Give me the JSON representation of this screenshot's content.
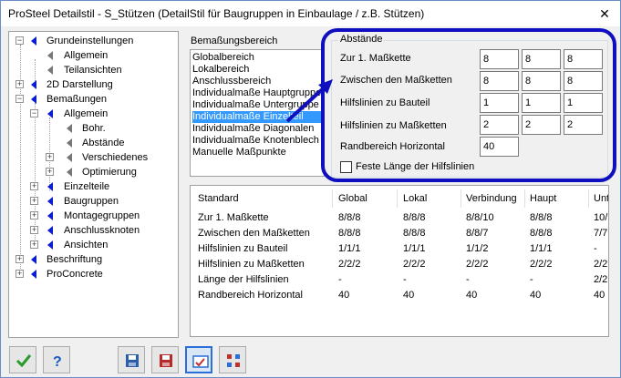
{
  "window": {
    "title": "ProSteel Detailstil - S_Stützen (DetailStil für Baugruppen in Einbaulage / z.B. Stützen)",
    "close_glyph": "✕"
  },
  "tree": {
    "items": [
      {
        "label": "Grundeinstellungen",
        "icon": "blue-triangle-icon"
      },
      {
        "label": "Allgemein",
        "icon": "gray-triangle-icon"
      },
      {
        "label": "Teilansichten",
        "icon": "gray-triangle-icon"
      },
      {
        "label": "2D Darstellung",
        "icon": "blue-triangle-icon"
      },
      {
        "label": "Bemaßungen",
        "icon": "blue-triangle-icon"
      },
      {
        "label": "Allgemein",
        "icon": "blue-triangle-icon"
      },
      {
        "label": "Bohr.",
        "icon": "gray-triangle-icon"
      },
      {
        "label": "Abstände",
        "icon": "gray-triangle-icon"
      },
      {
        "label": "Verschiedenes",
        "icon": "gray-triangle-icon"
      },
      {
        "label": "Optimierung",
        "icon": "gray-triangle-icon"
      },
      {
        "label": "Einzelteile",
        "icon": "blue-triangle-icon"
      },
      {
        "label": "Baugruppen",
        "icon": "blue-triangle-icon"
      },
      {
        "label": "Montagegruppen",
        "icon": "blue-triangle-icon"
      },
      {
        "label": "Anschlussknoten",
        "icon": "blue-triangle-icon"
      },
      {
        "label": "Ansichten",
        "icon": "blue-triangle-icon"
      },
      {
        "label": "Beschriftung",
        "icon": "blue-triangle-icon"
      },
      {
        "label": "ProConcrete",
        "icon": "blue-triangle-icon"
      }
    ],
    "selected": "Abstände"
  },
  "area": {
    "label": "Bemaßungsbereich",
    "items": [
      "Globalbereich",
      "Lokalbereich",
      "Anschlussbereich",
      "Individualmaße Hauptgruppe",
      "Individualmaße Untergruppe",
      "Individualmaße Einzelteil",
      "Individualmaße Diagonalen",
      "Individualmaße Knotenblech",
      "Manuelle Maßpunkte"
    ],
    "selected": "Individualmaße Einzelteil"
  },
  "distances": {
    "title": "Abstände",
    "rows": [
      {
        "label": "Zur 1. Maßkette",
        "values": [
          "8",
          "8",
          "8"
        ]
      },
      {
        "label": "Zwischen den Maßketten",
        "values": [
          "8",
          "8",
          "8"
        ]
      },
      {
        "label": "Hilfslinien zu Bauteil",
        "values": [
          "1",
          "1",
          "1"
        ]
      },
      {
        "label": "Hilfslinien zu Maßketten",
        "values": [
          "2",
          "2",
          "2"
        ]
      },
      {
        "label": "Randbereich Horizontal",
        "values": [
          "40"
        ]
      }
    ],
    "fixed_length_label": "Feste Länge der Hilfslinien",
    "fixed_length_checked": false,
    "highlight_color": "#0f0fbf"
  },
  "table": {
    "headers": [
      "Standard",
      "Global",
      "Lokal",
      "Verbindung",
      "Haupt",
      "Unt"
    ],
    "rows": [
      [
        "Zur 1. Maßkette",
        "8/8/8",
        "8/8/8",
        "8/8/10",
        "8/8/8",
        "10/"
      ],
      [
        "Zwischen den Maßketten",
        "8/8/8",
        "8/8/8",
        "8/8/7",
        "8/8/8",
        "7/7"
      ],
      [
        "Hilfslinien zu Bauteil",
        "1/1/1",
        "1/1/1",
        "1/1/2",
        "1/1/1",
        "-"
      ],
      [
        "Hilfslinien zu Maßketten",
        "2/2/2",
        "2/2/2",
        "2/2/2",
        "2/2/2",
        "2/2"
      ],
      [
        "Länge der Hilfslinien",
        "-",
        "-",
        "-",
        "-",
        "2/2"
      ],
      [
        "Randbereich Horizontal",
        "40",
        "40",
        "40",
        "40",
        "40"
      ]
    ]
  },
  "toolbar": {
    "buttons": [
      "ok-check-icon",
      "help-question-icon",
      "save-icon",
      "save-as-icon",
      "style-settings-icon",
      "grid-dots-icon"
    ]
  }
}
